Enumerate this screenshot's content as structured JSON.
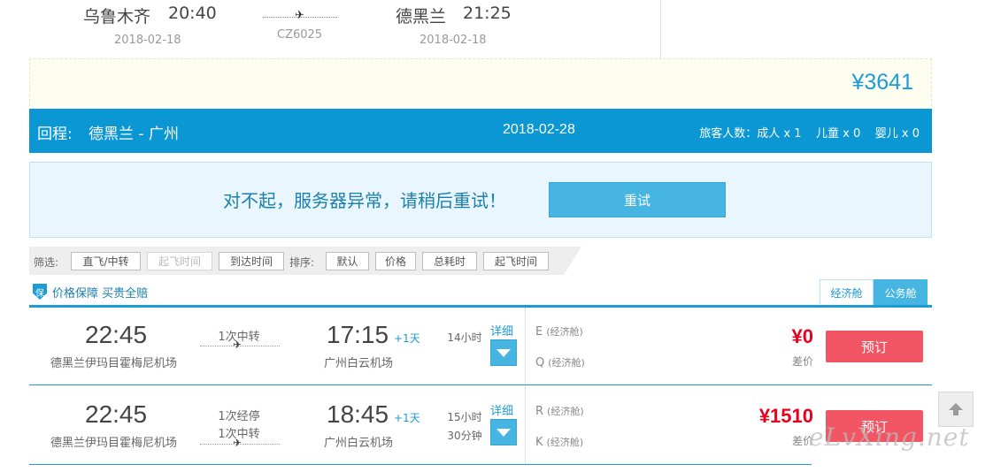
{
  "outbound": {
    "dep_city": "乌鲁木齐",
    "dep_time": "20:40",
    "dep_date": "2018-02-18",
    "flight_no": "CZ6025",
    "arr_city": "德黑兰",
    "arr_time": "21:25",
    "arr_date": "2018-02-18"
  },
  "total_price": "¥3641",
  "return_bar": {
    "label": "回程:",
    "route": "德黑兰 - 广州",
    "date": "2018-02-28",
    "passengers": "旅客人数：成人 x 1    儿童 x 0    婴儿 x 0"
  },
  "error": {
    "message": "对不起，服务器异常，请稍后重试！",
    "retry_label": "重试"
  },
  "filter": {
    "filter_label": "筛选:",
    "filter_buttons": [
      "直飞/中转",
      "起飞时间",
      "到达时间"
    ],
    "sort_label": "排序:",
    "sort_buttons": [
      "默认",
      "价格",
      "总耗时",
      "起飞时间"
    ]
  },
  "guarantee": {
    "icon_text": "保",
    "text": "价格保障 买贵全赔"
  },
  "cabin_tabs": [
    "经济舱",
    "公务舱"
  ],
  "flights": [
    {
      "dep_time": "22:45",
      "dep_airport": "德黑兰伊玛目霍梅尼机场",
      "transfer_lines": [
        "1次中转"
      ],
      "arr_time": "17:15",
      "plus_day": "+1天",
      "arr_airport": "广州白云机场",
      "duration_lines": [
        "14小时"
      ],
      "detail_label": "详细",
      "cabins": [
        {
          "code": "E",
          "name": "(经济舱)"
        },
        {
          "code": "Q",
          "name": "(经济舱)"
        }
      ],
      "price": "¥0",
      "price_note": "差价",
      "book_label": "预订"
    },
    {
      "dep_time": "22:45",
      "dep_airport": "德黑兰伊玛目霍梅尼机场",
      "transfer_lines": [
        "1次经停",
        "1次中转"
      ],
      "arr_time": "18:45",
      "plus_day": "+1天",
      "arr_airport": "广州白云机场",
      "duration_lines": [
        "15小时",
        "30分钟"
      ],
      "detail_label": "详细",
      "cabins": [
        {
          "code": "R",
          "name": "(经济舱)"
        },
        {
          "code": "K",
          "name": "(经济舱)"
        }
      ],
      "price": "¥1510",
      "price_note": "差价",
      "book_label": "预订"
    }
  ],
  "watermark": "eLvXing.net",
  "colors": {
    "brand_blue": "#0b96d4",
    "price_red": "#e8001c",
    "book_red": "#f25563"
  }
}
